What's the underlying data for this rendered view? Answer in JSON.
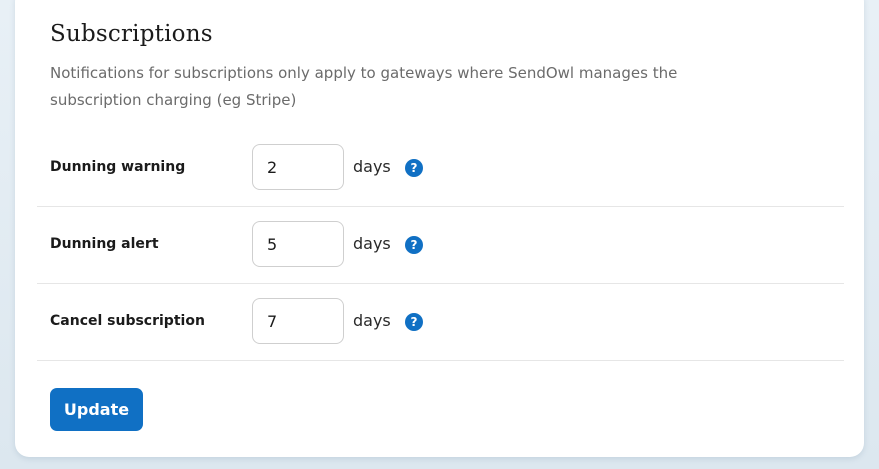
{
  "section": {
    "title": "Subscriptions",
    "description": "Notifications for subscriptions only apply to gateways where SendOwl manages the subscription charging (eg Stripe)"
  },
  "settings": [
    {
      "label": "Dunning warning",
      "value": "2",
      "unit": "days",
      "help": "?"
    },
    {
      "label": "Dunning alert",
      "value": "5",
      "unit": "days",
      "help": "?"
    },
    {
      "label": "Cancel subscription",
      "value": "7",
      "unit": "days",
      "help": "?"
    }
  ],
  "actions": {
    "update_label": "Update"
  },
  "colors": {
    "accent": "#1070c4",
    "background": "#dce7ef",
    "card": "#ffffff"
  }
}
